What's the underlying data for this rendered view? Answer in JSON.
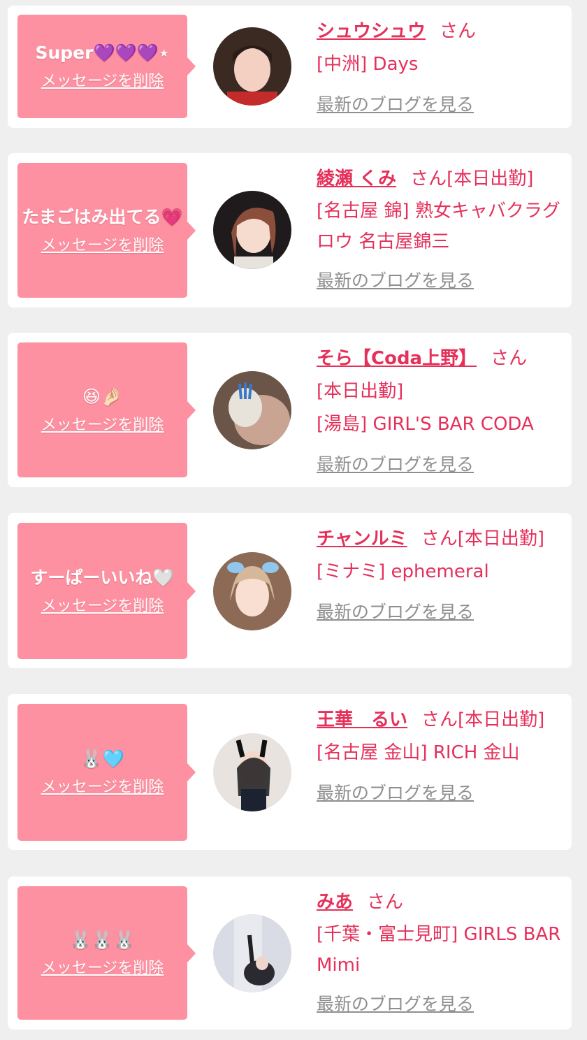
{
  "delete_label": "メッセージを削除",
  "blog_label": "最新のブログを見る",
  "honorific": "さん",
  "accent_color": "#e5305a",
  "bubble_color": "#fd91a1",
  "cards": [
    {
      "message": "Super💜💜💜⋆",
      "name": "シュウシュウ",
      "status": "",
      "shop": "[中洲] Days"
    },
    {
      "message": "たまごはみ出てる💗",
      "name": "綾瀬 くみ",
      "status": "[本日出勤]",
      "shop": "[名古屋 錦] 熟女キャバクラグロウ 名古屋錦三"
    },
    {
      "message": "😆🤌🏻",
      "name": "そら【Coda上野】",
      "status": "[本日出勤]",
      "shop": "[湯島] GIRL'S BAR CODA"
    },
    {
      "message": "すーぱーいいね🤍",
      "name": "チャンルミ",
      "status": "[本日出勤]",
      "shop": "[ミナミ] ephemeral"
    },
    {
      "message": "🐰🩵",
      "name": "王華　るい",
      "status": "[本日出勤]",
      "shop": "[名古屋 金山] RICH 金山"
    },
    {
      "message": "🐰🐰🐰",
      "name": "みあ",
      "status": "",
      "shop": "[千葉・富士見町] GIRLS BAR Mimi"
    }
  ]
}
